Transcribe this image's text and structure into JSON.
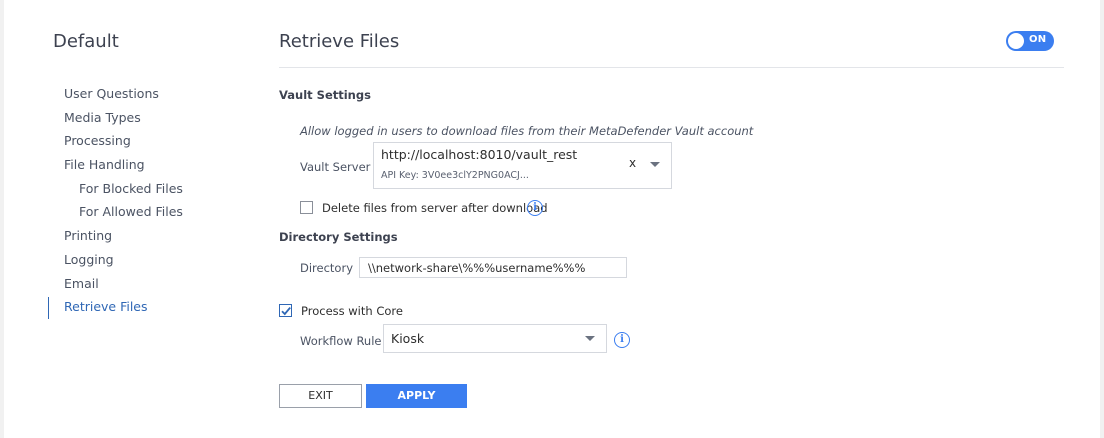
{
  "sidebar": {
    "title": "Default",
    "items": [
      {
        "label": "User Questions",
        "level": 0,
        "active": false
      },
      {
        "label": "Media Types",
        "level": 0,
        "active": false
      },
      {
        "label": "Processing",
        "level": 0,
        "active": false
      },
      {
        "label": "File Handling",
        "level": 0,
        "active": false
      },
      {
        "label": "For Blocked Files",
        "level": 1,
        "active": false
      },
      {
        "label": "For Allowed Files",
        "level": 1,
        "active": false
      },
      {
        "label": "Printing",
        "level": 0,
        "active": false
      },
      {
        "label": "Logging",
        "level": 0,
        "active": false
      },
      {
        "label": "Email",
        "level": 0,
        "active": false
      },
      {
        "label": "Retrieve Files",
        "level": 0,
        "active": true
      }
    ]
  },
  "main": {
    "title": "Retrieve Files",
    "toggle": {
      "label": "ON",
      "state": true
    }
  },
  "vault": {
    "heading": "Vault Settings",
    "hint": "Allow logged in users to download files from their MetaDefender Vault account",
    "server_label": "Vault Server",
    "server_url": "http://localhost:8010/vault_rest",
    "api_key": "API Key: 3V0ee3clY2PNG0ACJ...",
    "clear_label": "x",
    "delete_label": "Delete files from server after download",
    "delete_checked": false
  },
  "directory": {
    "heading": "Directory Settings",
    "label": "Directory",
    "value": "\\\\network-share\\%%%username%%%"
  },
  "core": {
    "label": "Process with Core",
    "checked": true,
    "workflow_label": "Workflow Rule",
    "workflow_value": "Kiosk"
  },
  "buttons": {
    "exit": "EXIT",
    "apply": "APPLY"
  },
  "colors": {
    "accent": "#3b7ef0",
    "active_nav": "#2f67b5",
    "background": "#f1f1f1"
  },
  "icons": {
    "info": "info-icon",
    "dropdown": "chevron-down-icon",
    "check": "check-icon"
  }
}
